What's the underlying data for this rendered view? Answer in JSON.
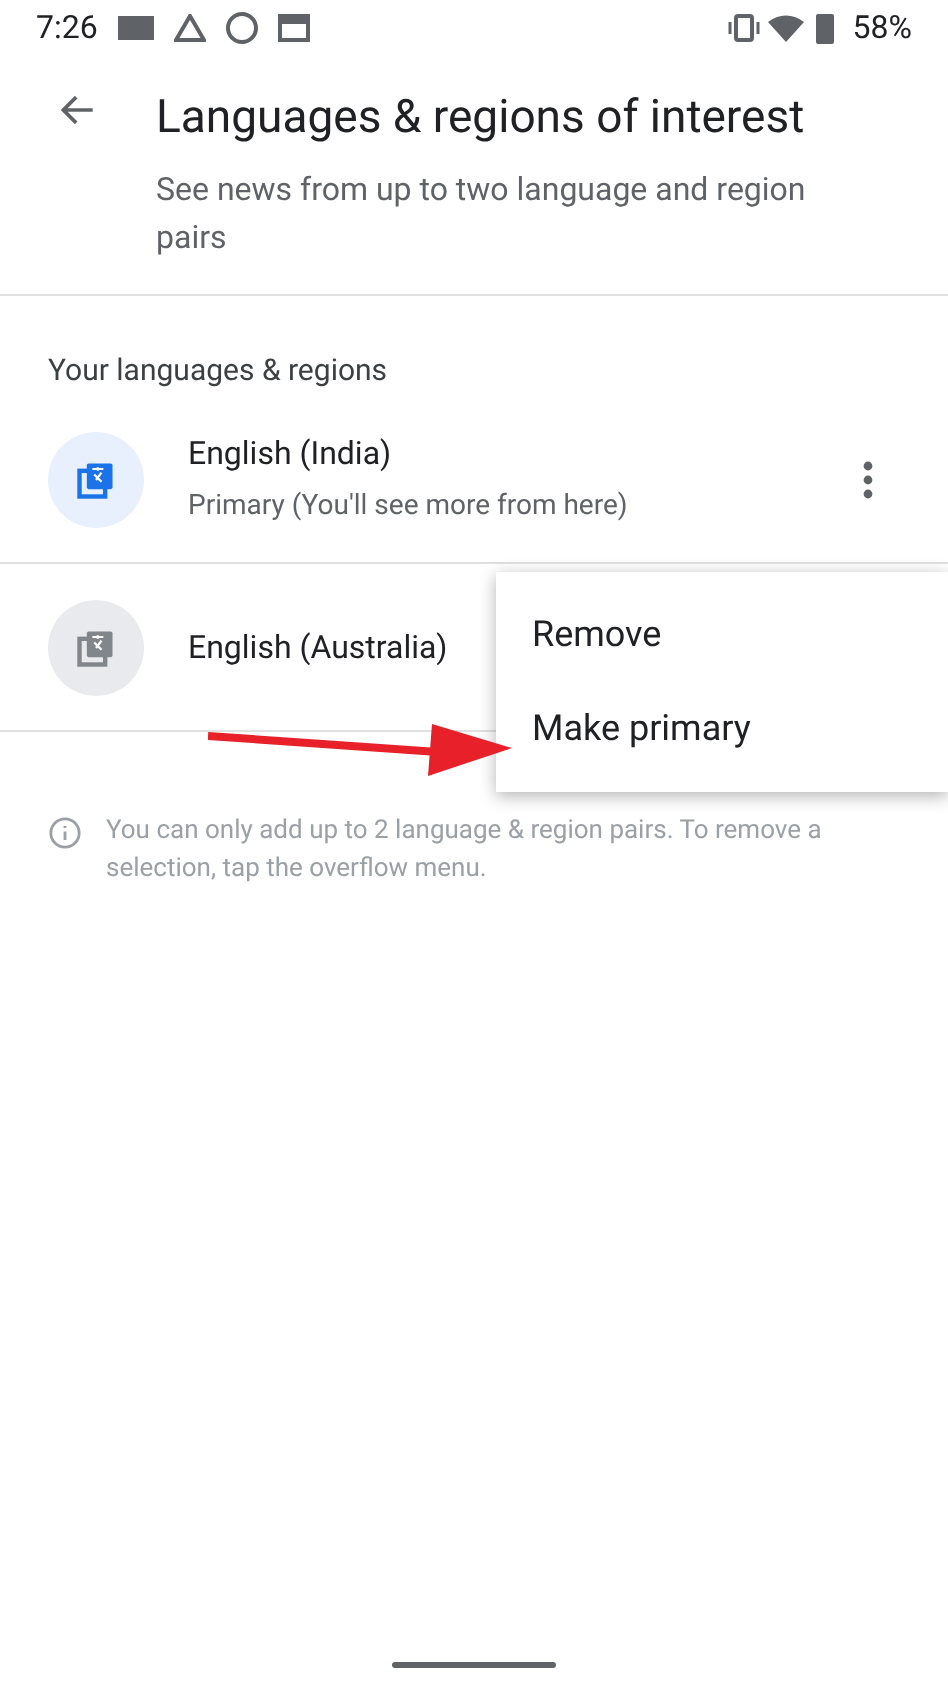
{
  "status_bar": {
    "time": "7:26",
    "battery": "58%"
  },
  "header": {
    "title": "Languages & regions of interest",
    "subtitle": "See news from up to two language and region pairs"
  },
  "section_title": "Your languages & regions",
  "languages": [
    {
      "name": "English (India)",
      "detail": "Primary (You'll see more from here)",
      "primary": true
    },
    {
      "name": "English (Australia)",
      "primary": false
    }
  ],
  "info": "You can only add up to 2 language & region pairs. To remove a selection, tap the overflow menu.",
  "menu": {
    "items": [
      "Remove",
      "Make primary"
    ]
  }
}
